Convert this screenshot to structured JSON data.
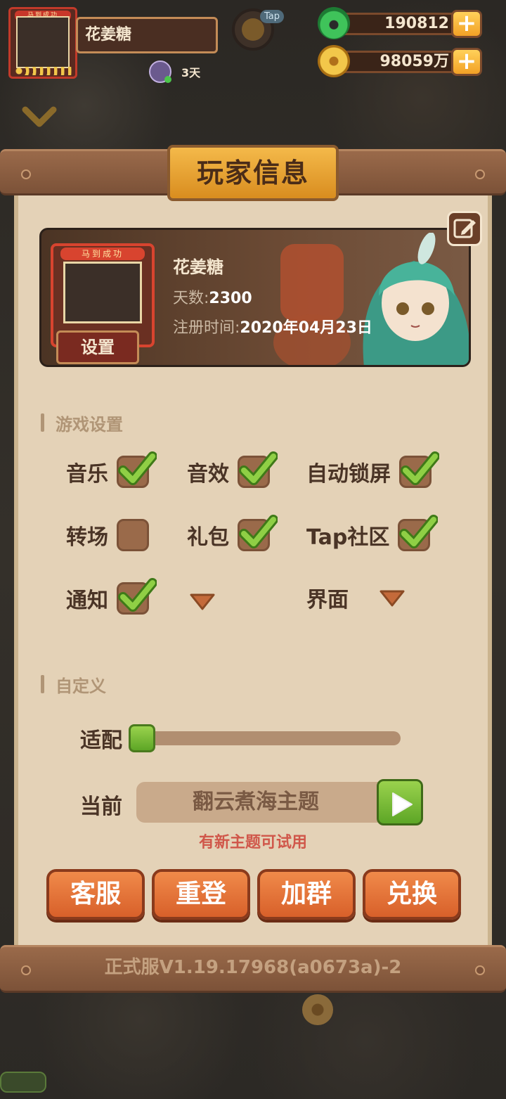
{
  "player": {
    "name": "花姜糖",
    "days_badge": "3天",
    "frame_ribbon": "马到成功"
  },
  "currency": {
    "jade_amount": "190812",
    "coin_amount": "98059万",
    "plus": "+"
  },
  "panel": {
    "title": "玩家信息",
    "version": "正式服V1.19.17968(a0673a)-2"
  },
  "profile": {
    "name": "花姜糖",
    "days_label": "天数:",
    "days_value": "2300",
    "reg_label": "注册时间:",
    "reg_value": "2020年04月23日",
    "set_button": "设置"
  },
  "game_settings": {
    "heading": "游戏设置",
    "options": [
      {
        "label": "音乐",
        "checked": true
      },
      {
        "label": "音效",
        "checked": true
      },
      {
        "label": "自动锁屏",
        "checked": true
      },
      {
        "label": "转场",
        "checked": false
      },
      {
        "label": "礼包",
        "checked": true
      },
      {
        "label": "Tap社区",
        "checked": true
      },
      {
        "label": "通知",
        "checked": true
      },
      {
        "label": "界面",
        "type": "dropdown"
      }
    ]
  },
  "custom": {
    "heading": "自定义",
    "fit_label": "适配",
    "fit_level": 0,
    "current_label": "当前",
    "current_theme": "翻云煮海主题",
    "hint": "有新主题可试用"
  },
  "actions": [
    "客服",
    "重登",
    "加群",
    "兑换"
  ],
  "colors": {
    "panel_bg": "#e4d2b7",
    "wood": "#8a5e42",
    "title_tab": "#f0a83a",
    "button_orange": "#e4713a",
    "check_green": "#6fbf3a",
    "hint_red": "#d0574a"
  }
}
